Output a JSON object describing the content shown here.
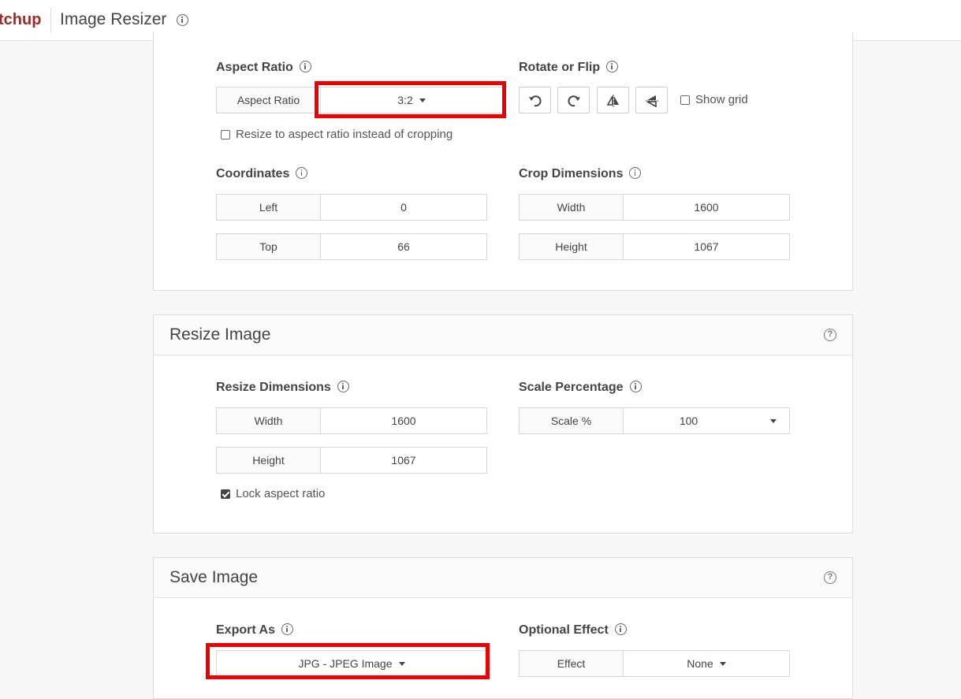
{
  "header": {
    "brand": "tchup",
    "title": "Image Resizer"
  },
  "crop_card": {
    "aspect_ratio": {
      "label": "Aspect Ratio",
      "addon": "Aspect Ratio",
      "value": "3:2",
      "resize_checkbox": "Resize to aspect ratio instead of cropping",
      "resize_checked": false
    },
    "rotate": {
      "label": "Rotate or Flip",
      "show_grid": "Show grid",
      "show_grid_checked": false,
      "buttons": [
        "rotate-left-icon",
        "rotate-right-icon",
        "flip-horizontal-icon",
        "flip-vertical-icon"
      ]
    },
    "coordinates": {
      "label": "Coordinates",
      "left_label": "Left",
      "left_value": "0",
      "top_label": "Top",
      "top_value": "66"
    },
    "crop_dimensions": {
      "label": "Crop Dimensions",
      "width_label": "Width",
      "width_value": "1600",
      "height_label": "Height",
      "height_value": "1067"
    }
  },
  "resize_card": {
    "title": "Resize Image",
    "help": "?",
    "dimensions": {
      "label": "Resize Dimensions",
      "width_label": "Width",
      "width_value": "1600",
      "height_label": "Height",
      "height_value": "1067",
      "lock": "Lock aspect ratio",
      "lock_checked": true
    },
    "scale": {
      "label": "Scale Percentage",
      "addon": "Scale %",
      "value": "100"
    }
  },
  "save_card": {
    "title": "Save Image",
    "help": "?",
    "export": {
      "label": "Export As",
      "value": "JPG - JPEG Image"
    },
    "effect": {
      "label": "Optional Effect",
      "addon": "Effect",
      "value": "None"
    }
  },
  "colors": {
    "brand": "#a12a25",
    "highlight": "#ee0000"
  }
}
